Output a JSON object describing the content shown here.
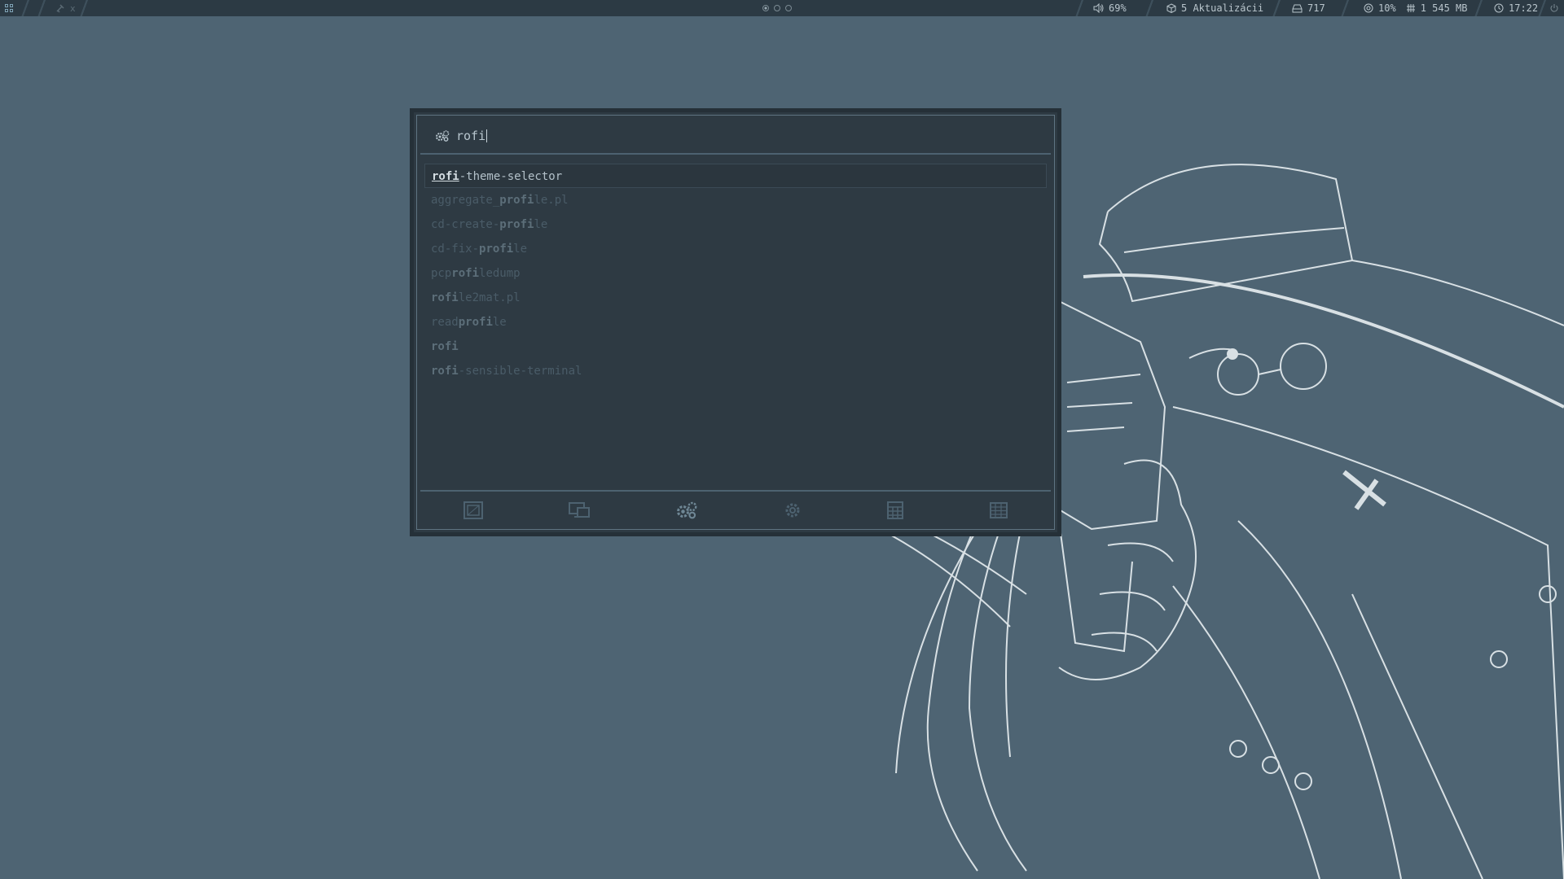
{
  "topbar": {
    "workspace_label": "x",
    "volume": "69%",
    "updates": "5 Aktualizácii",
    "disk": "717",
    "cpu": "10%",
    "memory": "1 545 MB",
    "clock": "17:22",
    "icons": [
      "app-grid-icon",
      "workspace-icon",
      "volume-icon",
      "package-icon",
      "disk-icon",
      "cpu-icon",
      "memory-icon",
      "clock-icon",
      "power-icon"
    ]
  },
  "rofi": {
    "input_text": "rofi",
    "prompt_icon": "gears-icon",
    "results": [
      {
        "pre": "",
        "m1": "rofi",
        "mid": "",
        "m2": "",
        "post": "-theme-selector"
      },
      {
        "pre": "aggregate_",
        "m1": "pro",
        "mid": "",
        "m2": "fi",
        "post": "le.pl"
      },
      {
        "pre": "cd-create-",
        "m1": "pro",
        "mid": "",
        "m2": "fi",
        "post": "le"
      },
      {
        "pre": "cd-fix-",
        "m1": "pro",
        "mid": "",
        "m2": "fi",
        "post": "le"
      },
      {
        "pre": "pcp",
        "m1": "rofi",
        "mid": "",
        "m2": "",
        "post": "ledump"
      },
      {
        "pre": "",
        "m1": "ro",
        "mid": "",
        "m2": "fi",
        "post": "le2mat.pl"
      },
      {
        "pre": "read",
        "m1": "pro",
        "mid": "",
        "m2": "fi",
        "post": "le"
      },
      {
        "pre": "",
        "m1": "rofi",
        "mid": "",
        "m2": "",
        "post": ""
      },
      {
        "pre": "",
        "m1": "rofi",
        "mid": "",
        "m2": "",
        "post": "-sensible-terminal"
      }
    ],
    "modes": [
      "window-icon",
      "screen-switch-icon",
      "gears-icon",
      "gear-icon",
      "calculator-icon",
      "table-icon"
    ],
    "active_mode_index": 2
  },
  "colors": {
    "desktop": "#4e6473",
    "bar": "#2c3a44",
    "rofi_bg": "#2e3a43",
    "rofi_text": "#b3c1c9",
    "rofi_dim": "#4a5c68"
  }
}
